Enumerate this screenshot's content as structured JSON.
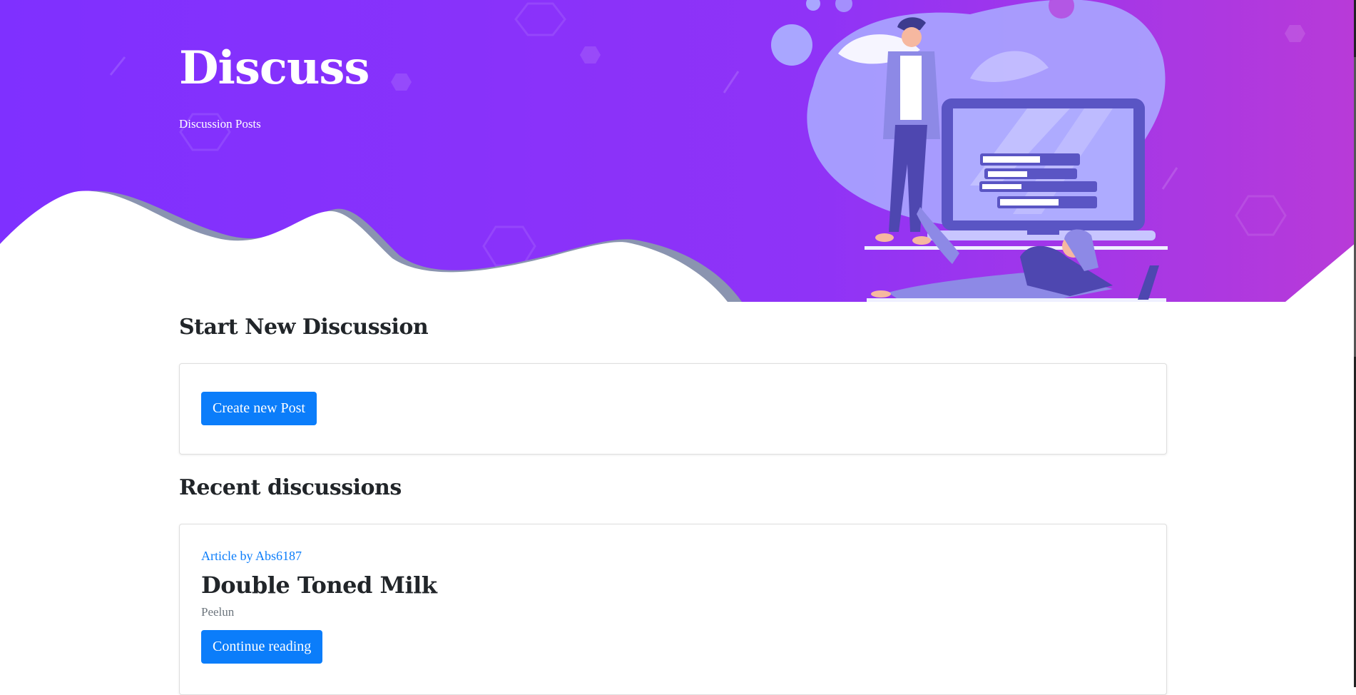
{
  "hero": {
    "title": "Discuss",
    "subtitle": "Discussion Posts"
  },
  "start_section": {
    "heading": "Start New Discussion",
    "button_label": "Create new Post"
  },
  "recent_section": {
    "heading": "Recent discussions",
    "posts": [
      {
        "meta": "Article by Abs6187",
        "title": "Double Toned Milk",
        "excerpt": "Peelun",
        "button_label": "Continue reading"
      }
    ]
  },
  "colors": {
    "hero_gradient_start": "#7f30ff",
    "hero_gradient_end": "#b83ad8",
    "primary_button": "#0b7dfa",
    "link": "#0b7dfa",
    "muted_text": "#6c757d"
  }
}
